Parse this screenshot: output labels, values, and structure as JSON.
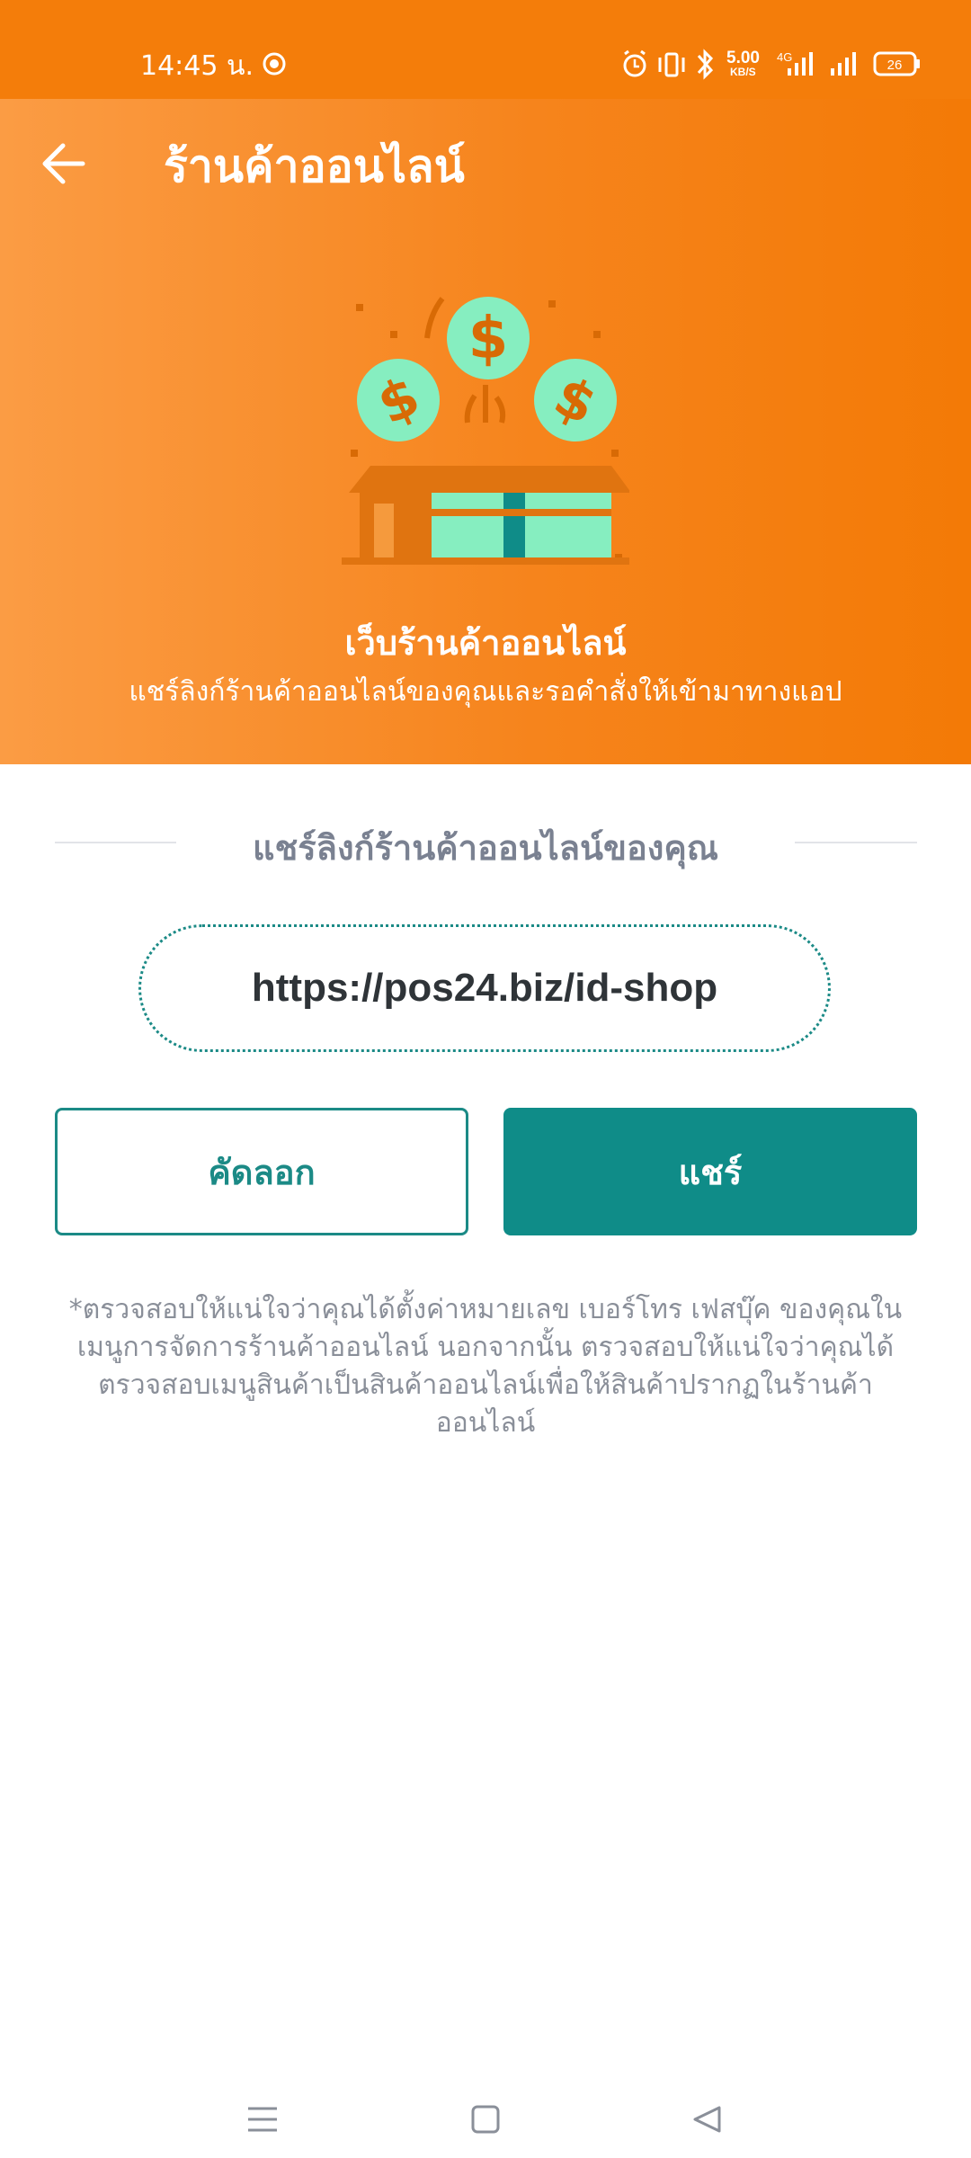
{
  "status_bar": {
    "time": "14:45 น.",
    "net_speed": "5.00",
    "net_unit": "KB/S",
    "network_type": "4G",
    "battery": "26"
  },
  "app_bar": {
    "title": "ร้านค้าออนไลน์",
    "back_icon": "arrow-left-icon"
  },
  "hero": {
    "illustration": "money-shop-icon",
    "title": "เว็บร้านค้าออนไลน์",
    "subtitle": "แชร์ลิงก์ร้านค้าออนไลน์ของคุณและรอคำสั่งให้เข้ามาทางแอป"
  },
  "share_section": {
    "heading": "แชร์ลิงก์ร้านค้าออนไลน์ของคุณ",
    "url": "https://pos24.biz/id-shop",
    "copy_label": "คัดลอก",
    "share_label": "แชร์"
  },
  "note": "*ตรวจสอบให้แน่ใจว่าคุณได้ตั้งค่าหมายเลข เบอร์โทร เฟสบุ๊ค ของคุณในเมนูการจัดการร้านค้าออนไลน์ นอกจากนั้น ตรวจสอบให้แน่ใจว่าคุณได้ตรวจสอบเมนูสินค้าเป็นสินค้าออนไลน์เพื่อให้สินค้าปรากฏในร้านค้าออนไลน์",
  "colors": {
    "brand_orange": "#f6841c",
    "teal": "#0f8c88",
    "mint": "#86eec0"
  },
  "nav_bar": {
    "menu_icon": "menu-icon",
    "home_icon": "home-square-icon",
    "back_icon": "back-triangle-icon"
  }
}
